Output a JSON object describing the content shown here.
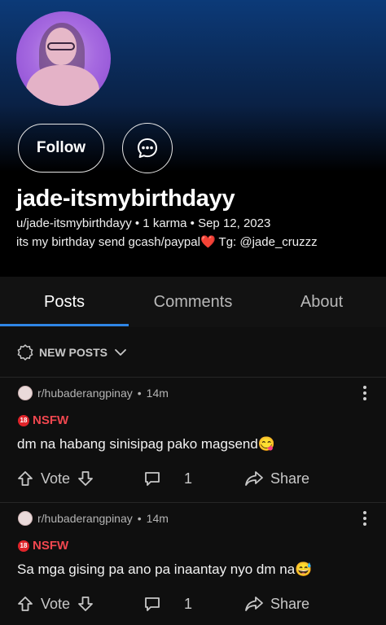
{
  "profile": {
    "username": "jade-itsmybirthdayy",
    "meta": "u/jade-itsmybirthdayy • 1 karma • Sep 12, 2023",
    "bio": "its my birthday send gcash/paypal",
    "bio_emoji": "❤️",
    "bio_tail": " Tg: @jade_cruzzz",
    "follow_label": "Follow"
  },
  "tabs": [
    "Posts",
    "Comments",
    "About"
  ],
  "sort": {
    "label": "NEW POSTS"
  },
  "posts": [
    {
      "subreddit": "r/hubaderangpinay",
      "age": "14m",
      "nsfw": "NSFW",
      "text": "dm na habang sinisipag pako magsend😋",
      "vote": "Vote",
      "comments": "1",
      "share": "Share"
    },
    {
      "subreddit": "r/hubaderangpinay",
      "age": "14m",
      "nsfw": "NSFW",
      "text": "Sa mga gising pa ano pa inaantay nyo dm na😅",
      "vote": "Vote",
      "comments": "1",
      "share": "Share"
    }
  ],
  "colors": {
    "accent": "#2f86e6",
    "nsfw": "#e0242a"
  }
}
